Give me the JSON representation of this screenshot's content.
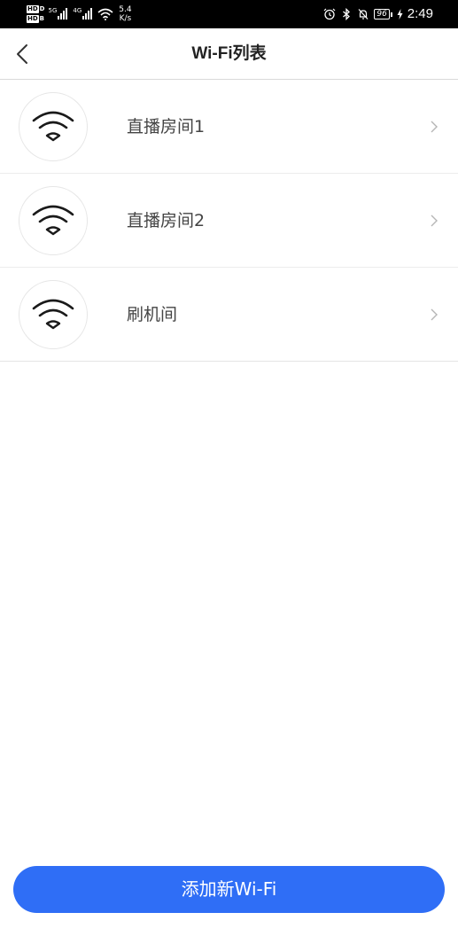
{
  "status_bar": {
    "hd_labels": [
      "HD",
      "HD"
    ],
    "hd_suffix": [
      "D",
      "B"
    ],
    "sim1_generation": "5G",
    "sim2_generation": "4G",
    "net_speed_value": "5.4",
    "net_speed_unit": "K/s",
    "battery_level": "96",
    "time": "2:49",
    "icons": [
      "alarm-icon",
      "bluetooth-icon",
      "notifications-off-icon",
      "battery-icon",
      "charging-icon"
    ]
  },
  "header": {
    "title": "Wi-Fi列表",
    "back_icon": "chevron-left-icon"
  },
  "wifi_list": {
    "items": [
      {
        "name": "直播房间1",
        "icon": "wifi-icon"
      },
      {
        "name": "直播房间2",
        "icon": "wifi-icon"
      },
      {
        "name": "刷机间",
        "icon": "wifi-icon"
      }
    ]
  },
  "footer": {
    "add_button_label": "添加新Wi-Fi"
  },
  "colors": {
    "primary": "#2f6ef6",
    "status_bar_bg": "#000000",
    "text_primary": "#222222",
    "text_item": "#444444",
    "divider": "#ececec"
  }
}
